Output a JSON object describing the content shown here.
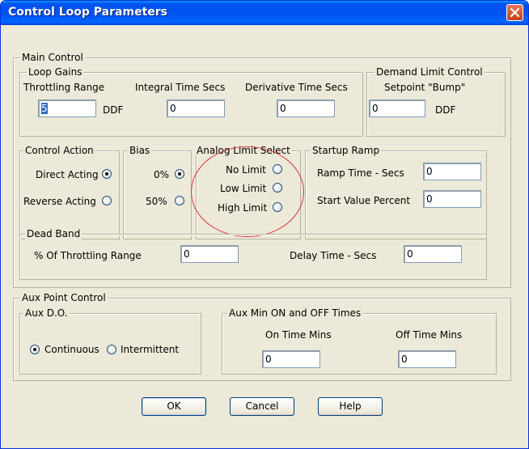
{
  "window": {
    "title": "Control  Loop Parameters"
  },
  "main_control": {
    "label": "Main Control",
    "loop_gains": {
      "label": "Loop Gains",
      "throttling_range": {
        "label": "Throttling Range",
        "value": "5",
        "unit": "DDF"
      },
      "integral_time": {
        "label": "Integral Time Secs",
        "value": "0"
      },
      "derivative_time": {
        "label": "Derivative Time Secs",
        "value": "0"
      }
    },
    "demand_limit": {
      "label": "Demand Limit Control",
      "sublabel": "Setpoint \"Bump\"",
      "value": "0",
      "unit": "DDF"
    },
    "control_action": {
      "label": "Control Action",
      "options": [
        "Direct Acting",
        "Reverse Acting"
      ],
      "selected": "Direct Acting"
    },
    "bias": {
      "label": "Bias",
      "options": [
        "0%",
        "50%"
      ],
      "selected": "0%"
    },
    "analog_limit": {
      "label": "Analog Limit Select",
      "options": [
        "No Limit",
        "Low Limit",
        "High Limit"
      ],
      "selected": ""
    },
    "startup_ramp": {
      "label": "Startup Ramp",
      "ramp_time": {
        "label": "Ramp Time - Secs",
        "value": "0"
      },
      "start_value": {
        "label": "Start Value Percent",
        "value": "0"
      }
    },
    "dead_band": {
      "label": "Dead Band",
      "throttling_pct": {
        "label": "% Of Throttling Range",
        "value": "0"
      },
      "delay_time": {
        "label": "Delay Time - Secs",
        "value": "0"
      }
    }
  },
  "aux_point": {
    "label": "Aux Point Control",
    "aux_do": {
      "label": "Aux D.O.",
      "options": [
        "Continuous",
        "Intermittent"
      ],
      "selected": "Continuous"
    },
    "min_times": {
      "label": "Aux Min ON and OFF Times",
      "on_time": {
        "label": "On Time Mins",
        "value": "0"
      },
      "off_time": {
        "label": "Off Time Mins",
        "value": "0"
      }
    }
  },
  "buttons": {
    "ok": "OK",
    "cancel": "Cancel",
    "help": "Help"
  },
  "colors": {
    "titlebar": "#0053ee",
    "annotation_circle": "#d7373a",
    "close_button": "#d4532d"
  },
  "icons": {
    "close": "close-icon"
  }
}
